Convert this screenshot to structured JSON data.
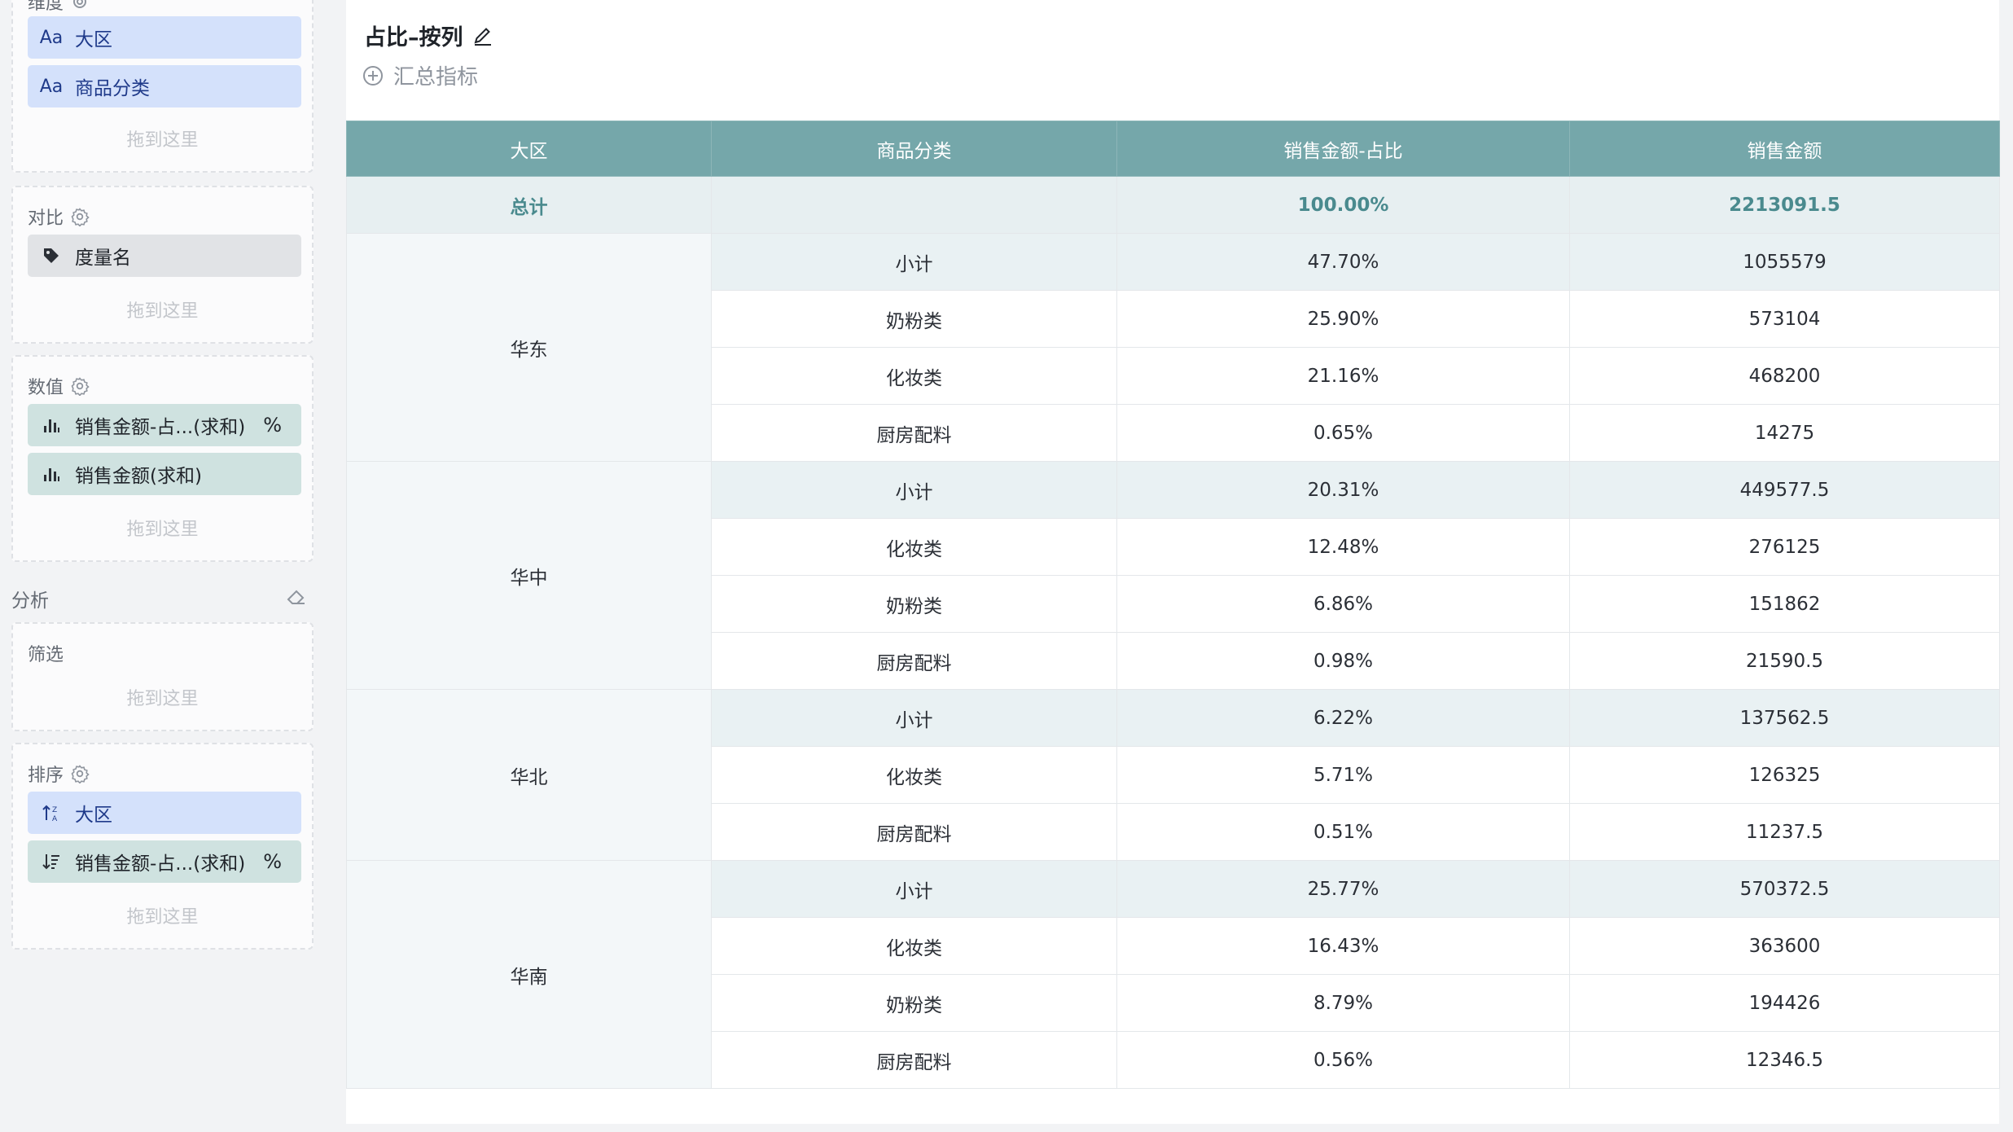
{
  "left_panel": {
    "dimension_section": {
      "title": "维度",
      "chips": [
        {
          "icon": "text-type-icon",
          "glyph": "Aa",
          "label": "大区"
        },
        {
          "icon": "text-type-icon",
          "glyph": "Aa",
          "label": "商品分类"
        }
      ],
      "drop_hint": "拖到这里"
    },
    "compare_section": {
      "title": "对比",
      "chips": [
        {
          "icon": "tag-icon",
          "label": "度量名"
        }
      ],
      "drop_hint": "拖到这里"
    },
    "value_section": {
      "title": "数值",
      "chips": [
        {
          "icon": "bar-chart-icon",
          "label": "销售金额-占...(求和)",
          "suffix": "%"
        },
        {
          "icon": "bar-chart-icon",
          "label": "销售金额(求和)"
        }
      ],
      "drop_hint": "拖到这里"
    },
    "analysis_title": "分析",
    "filter_section": {
      "title": "筛选",
      "drop_hint": "拖到这里"
    },
    "sort_section": {
      "title": "排序",
      "chips": [
        {
          "icon": "sort-asc-icon",
          "label": "大区"
        },
        {
          "icon": "sort-desc-icon",
          "label": "销售金额-占...(求和)",
          "suffix": "%"
        }
      ],
      "drop_hint": "拖到这里"
    }
  },
  "main": {
    "title": "占比–按列",
    "add_metric_label": "汇总指标",
    "table": {
      "columns": [
        "大区",
        "商品分类",
        "销售金额-占比",
        "销售金额"
      ],
      "total_row": {
        "label": "总计",
        "pct": "100.00%",
        "amount": "2213091.5"
      },
      "groups": [
        {
          "region": "华东",
          "rows": [
            {
              "category": "小计",
              "pct": "47.70%",
              "amount": "1055579",
              "subtotal": true
            },
            {
              "category": "奶粉类",
              "pct": "25.90%",
              "amount": "573104"
            },
            {
              "category": "化妆类",
              "pct": "21.16%",
              "amount": "468200"
            },
            {
              "category": "厨房配料",
              "pct": "0.65%",
              "amount": "14275"
            }
          ]
        },
        {
          "region": "华中",
          "rows": [
            {
              "category": "小计",
              "pct": "20.31%",
              "amount": "449577.5",
              "subtotal": true
            },
            {
              "category": "化妆类",
              "pct": "12.48%",
              "amount": "276125"
            },
            {
              "category": "奶粉类",
              "pct": "6.86%",
              "amount": "151862"
            },
            {
              "category": "厨房配料",
              "pct": "0.98%",
              "amount": "21590.5"
            }
          ]
        },
        {
          "region": "华北",
          "rows": [
            {
              "category": "小计",
              "pct": "6.22%",
              "amount": "137562.5",
              "subtotal": true
            },
            {
              "category": "化妆类",
              "pct": "5.71%",
              "amount": "126325"
            },
            {
              "category": "厨房配料",
              "pct": "0.51%",
              "amount": "11237.5"
            }
          ]
        },
        {
          "region": "华南",
          "rows": [
            {
              "category": "小计",
              "pct": "25.77%",
              "amount": "570372.5",
              "subtotal": true
            },
            {
              "category": "化妆类",
              "pct": "16.43%",
              "amount": "363600"
            },
            {
              "category": "奶粉类",
              "pct": "8.79%",
              "amount": "194426"
            },
            {
              "category": "厨房配料",
              "pct": "0.56%",
              "amount": "12346.5"
            }
          ]
        }
      ]
    }
  },
  "colors": {
    "header_bg": "#75a7aa",
    "dimension_chip": "#d4e1fb",
    "value_chip": "#cfe2e0",
    "total_text": "#4a8a8e"
  }
}
